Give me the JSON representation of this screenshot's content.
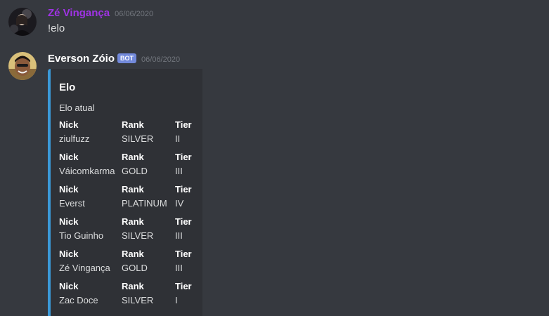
{
  "messages": [
    {
      "username": "Zé Vingança",
      "username_color": "#a033e6",
      "timestamp": "06/06/2020",
      "content": "!elo",
      "avatar": "user-avatar-icon"
    },
    {
      "username": "Everson Zóio",
      "bot_tag": "BOT",
      "timestamp": "06/06/2020",
      "avatar": "bot-avatar-icon",
      "embed": {
        "accent_color": "#3b9ad9",
        "title": "Elo",
        "description": "Elo atual",
        "field_names": {
          "nick": "Nick",
          "rank": "Rank",
          "tier": "Tier"
        },
        "rows": [
          {
            "nick": "ziulfuzz",
            "rank": "SILVER",
            "tier": "II"
          },
          {
            "nick": "Váicomkarma",
            "rank": "GOLD",
            "tier": "III"
          },
          {
            "nick": "Everst",
            "rank": "PLATINUM",
            "tier": "IV"
          },
          {
            "nick": "Tio Guinho",
            "rank": "SILVER",
            "tier": "III"
          },
          {
            "nick": "Zé Vingança",
            "rank": "GOLD",
            "tier": "III"
          },
          {
            "nick": "Zac Doce",
            "rank": "SILVER",
            "tier": "I"
          }
        ]
      }
    }
  ]
}
